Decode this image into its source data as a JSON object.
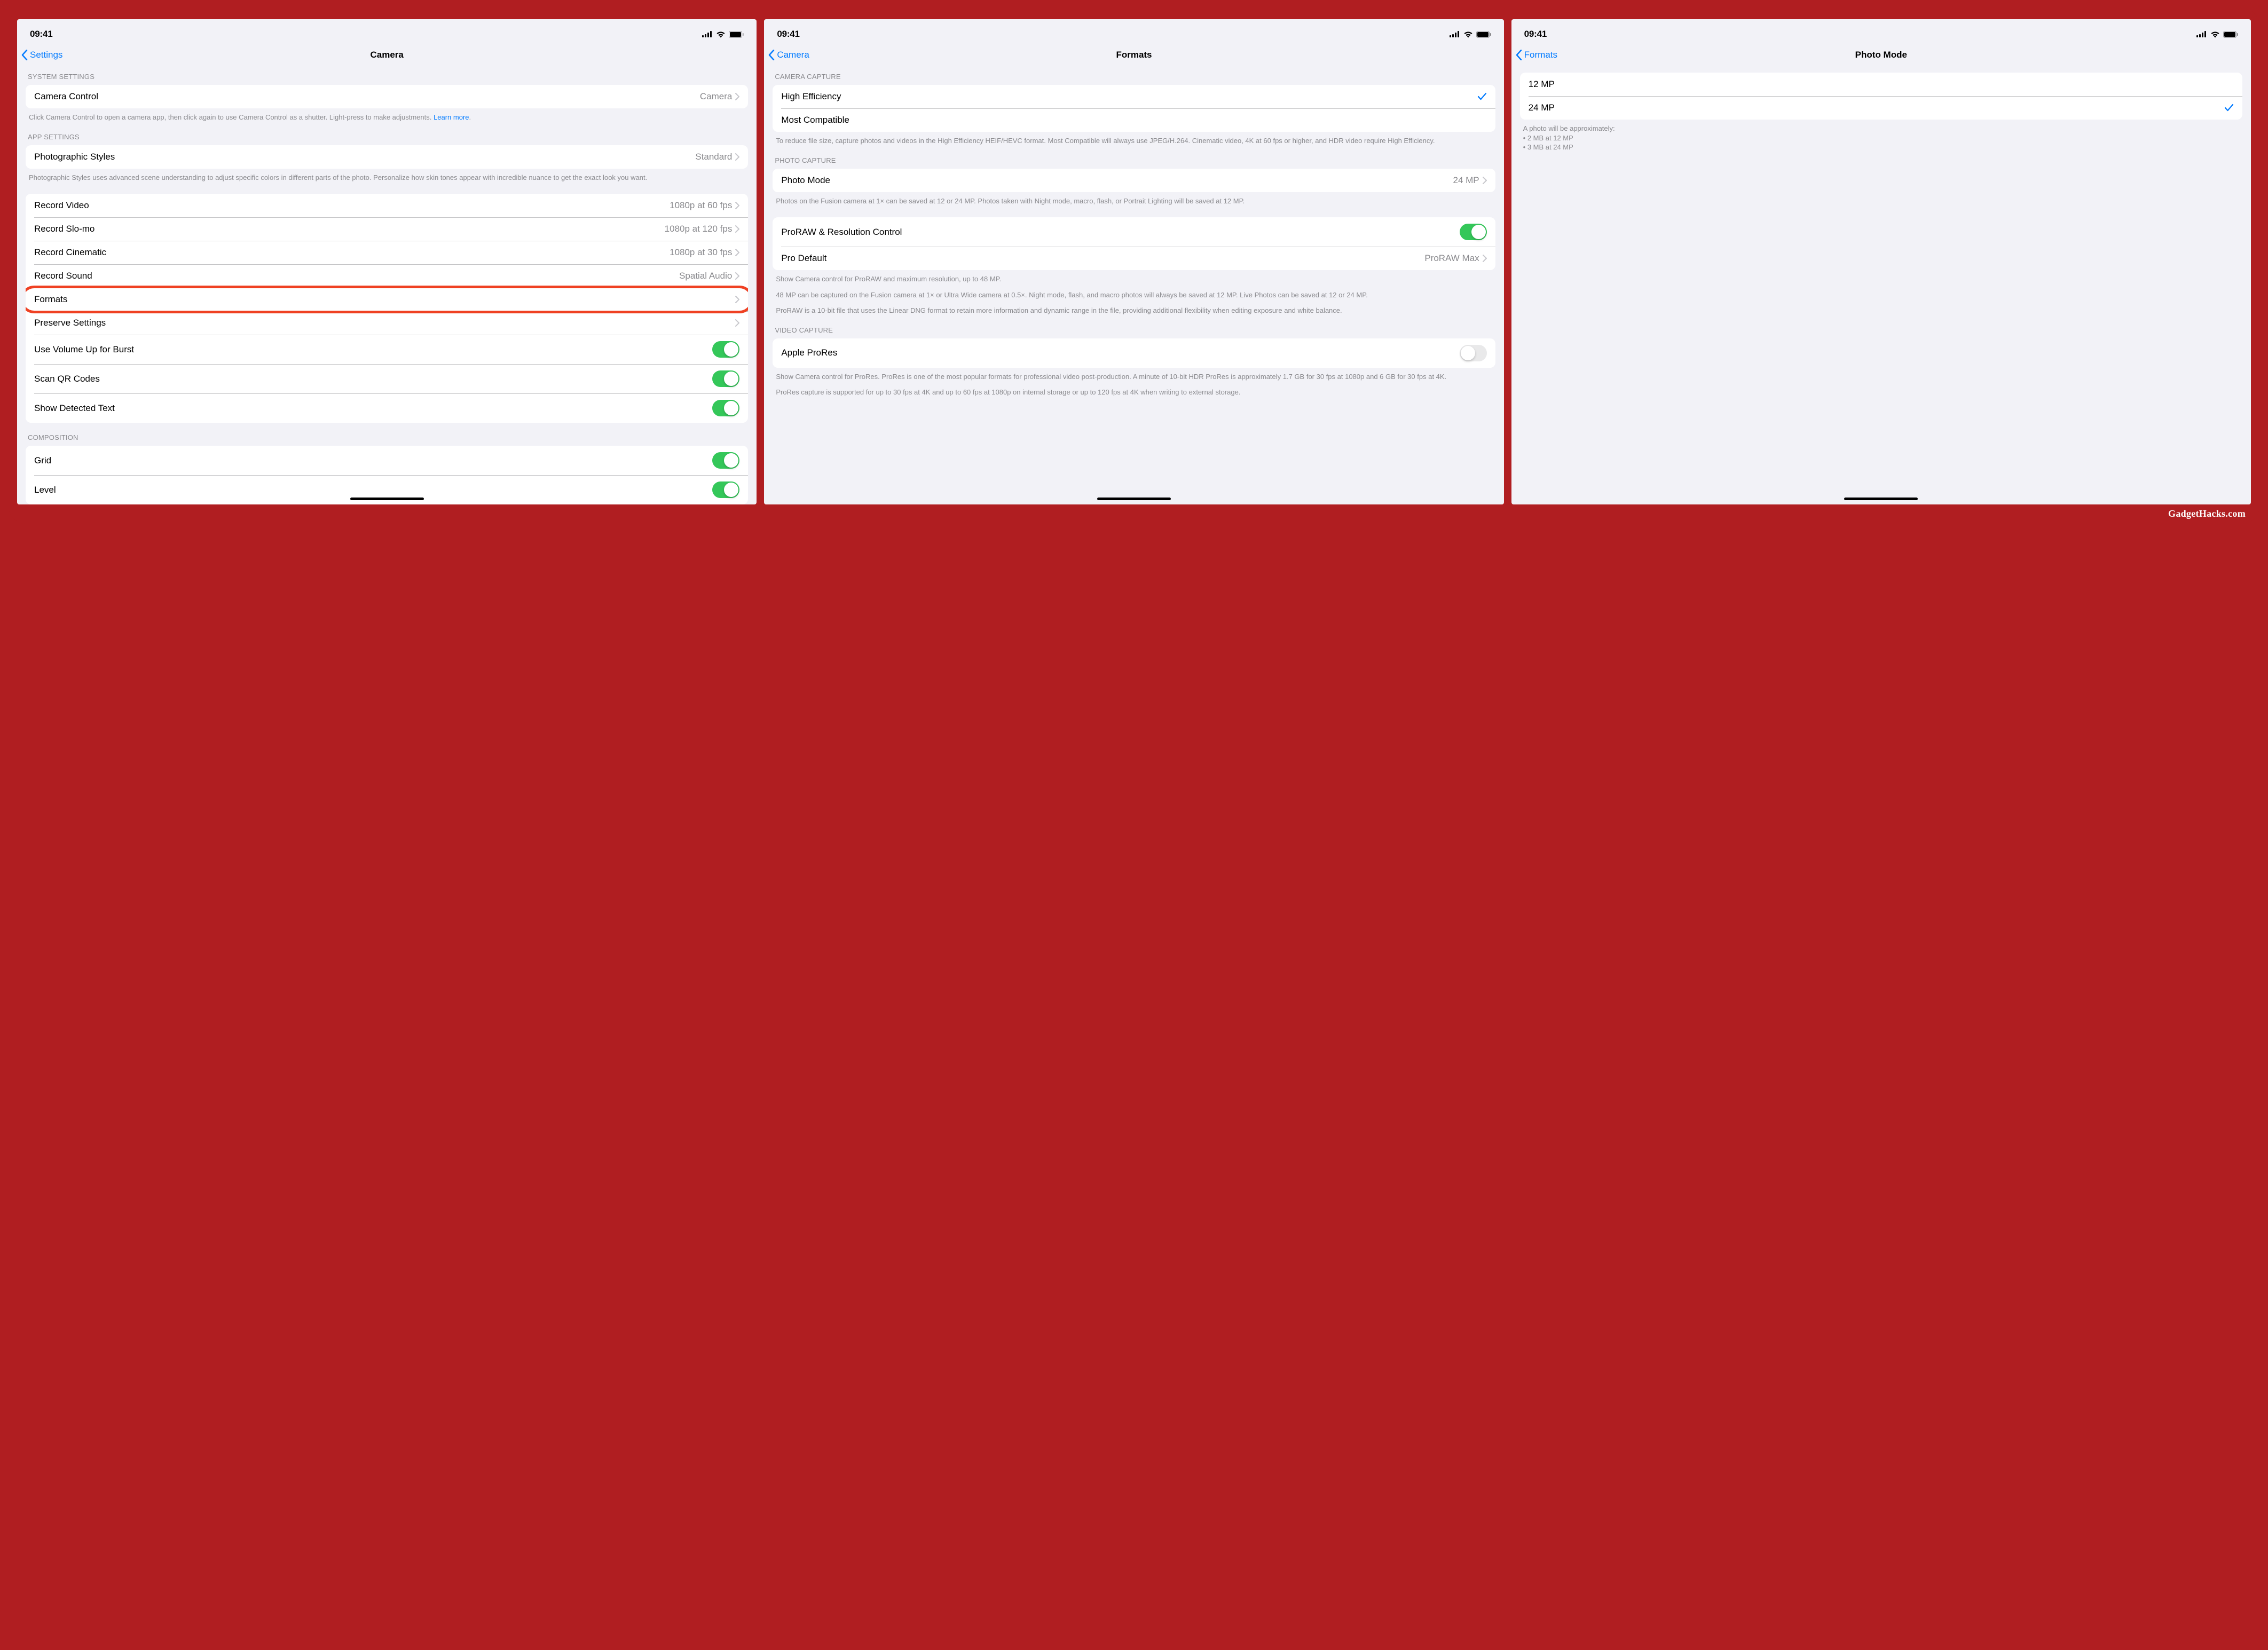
{
  "status_time": "09:41",
  "watermark": "GadgetHacks.com",
  "screens": [
    {
      "back_label": "Settings",
      "title": "Camera",
      "sections": {
        "system": {
          "header": "SYSTEM SETTINGS",
          "camera_control": {
            "label": "Camera Control",
            "value": "Camera"
          },
          "footer": "Click Camera Control to open a camera app, then click again to use Camera Control as a shutter. Light-press to make adjustments.",
          "learn_more": "Learn more"
        },
        "app": {
          "header": "APP SETTINGS",
          "photographic_styles": {
            "label": "Photographic Styles",
            "value": "Standard"
          },
          "footer": "Photographic Styles uses advanced scene understanding to adjust specific colors in different parts of the photo. Personalize how skin tones appear with incredible nuance to get the exact look you want."
        },
        "record": {
          "record_video": {
            "label": "Record Video",
            "value": "1080p at 60 fps"
          },
          "record_slomo": {
            "label": "Record Slo-mo",
            "value": "1080p at 120 fps"
          },
          "record_cinematic": {
            "label": "Record Cinematic",
            "value": "1080p at 30 fps"
          },
          "record_sound": {
            "label": "Record Sound",
            "value": "Spatial Audio"
          },
          "formats": {
            "label": "Formats"
          },
          "preserve": {
            "label": "Preserve Settings"
          },
          "volume_up": {
            "label": "Use Volume Up for Burst"
          },
          "scan_qr": {
            "label": "Scan QR Codes"
          },
          "detected_text": {
            "label": "Show Detected Text"
          }
        },
        "composition": {
          "header": "COMPOSITION",
          "grid": {
            "label": "Grid"
          },
          "level": {
            "label": "Level"
          }
        }
      }
    },
    {
      "back_label": "Camera",
      "title": "Formats",
      "sections": {
        "capture": {
          "header": "CAMERA CAPTURE",
          "high_efficiency": {
            "label": "High Efficiency"
          },
          "most_compatible": {
            "label": "Most Compatible"
          },
          "footer": "To reduce file size, capture photos and videos in the High Efficiency HEIF/HEVC format. Most Compatible will always use JPEG/H.264. Cinematic video, 4K at 60 fps or higher, and HDR video require High Efficiency."
        },
        "photo": {
          "header": "PHOTO CAPTURE",
          "photo_mode": {
            "label": "Photo Mode",
            "value": "24 MP"
          },
          "footer": "Photos on the Fusion camera at 1× can be saved at 12 or 24 MP. Photos taken with Night mode, macro, flash, or Portrait Lighting will be saved at 12 MP."
        },
        "proraw": {
          "proraw_control": {
            "label": "ProRAW & Resolution Control"
          },
          "pro_default": {
            "label": "Pro Default",
            "value": "ProRAW Max"
          },
          "footer1": "Show Camera control for ProRAW and maximum resolution, up to 48 MP.",
          "footer2": "48 MP can be captured on the Fusion camera at 1× or Ultra Wide camera at 0.5×. Night mode, flash, and macro photos will always be saved at 12 MP. Live Photos can be saved at 12 or 24 MP.",
          "footer3": "ProRAW is a 10-bit file that uses the Linear DNG format to retain more information and dynamic range in the file, providing additional flexibility when editing exposure and white balance."
        },
        "video": {
          "header": "VIDEO CAPTURE",
          "prores": {
            "label": "Apple ProRes"
          },
          "footer1": "Show Camera control for ProRes. ProRes is one of the most popular formats for professional video post-production. A minute of 10-bit HDR ProRes is approximately 1.7 GB for 30 fps at 1080p and 6 GB for 30 fps at 4K.",
          "footer2": "ProRes capture is supported for up to 30 fps at 4K and up to 60 fps at 1080p on internal storage or up to 120 fps at 4K when writing to external storage."
        }
      }
    },
    {
      "back_label": "Formats",
      "title": "Photo Mode",
      "options": {
        "opt1": "12 MP",
        "opt2": "24 MP"
      },
      "footer": {
        "line1": "A photo will be approximately:",
        "line2": "• 2 MB at 12 MP",
        "line3": "• 3 MB at 24 MP"
      }
    }
  ]
}
